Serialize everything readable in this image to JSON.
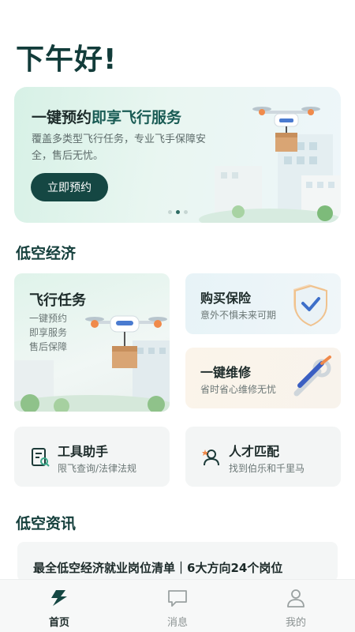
{
  "greeting": "下午好!",
  "banner": {
    "title_plain": "一键预约",
    "title_accent": "即享飞行服务",
    "subtitle": "覆盖多类型飞行任务，专业飞手保障安全，售后无忧。",
    "button": "立即预约",
    "slide_count": 3,
    "active_slide": 1
  },
  "section_economy": "低空经济",
  "cards": {
    "flight": {
      "title": "飞行任务",
      "lines": [
        "一键预约",
        "即享服务",
        "售后保障"
      ]
    },
    "insurance": {
      "title": "购买保险",
      "subtitle": "意外不惧未来可期"
    },
    "repair": {
      "title": "一键维修",
      "subtitle": "省时省心维修无忧"
    },
    "tools": {
      "title": "工具助手",
      "subtitle": "限飞查询/法律法规"
    },
    "talent": {
      "title": "人才匹配",
      "subtitle": "找到伯乐和千里马"
    }
  },
  "section_news": "低空资讯",
  "news": [
    {
      "title": "最全低空经济就业岗位清单｜6大方向24个岗位"
    }
  ],
  "tabbar": {
    "items": [
      {
        "label": "首页",
        "icon": "home-logo-icon",
        "active": true
      },
      {
        "label": "消息",
        "icon": "message-icon",
        "active": false
      },
      {
        "label": "我的",
        "icon": "profile-icon",
        "active": false
      }
    ]
  },
  "colors": {
    "primary": "#154743",
    "accent": "#1a5c55",
    "drone_orange": "#f08a4b"
  }
}
